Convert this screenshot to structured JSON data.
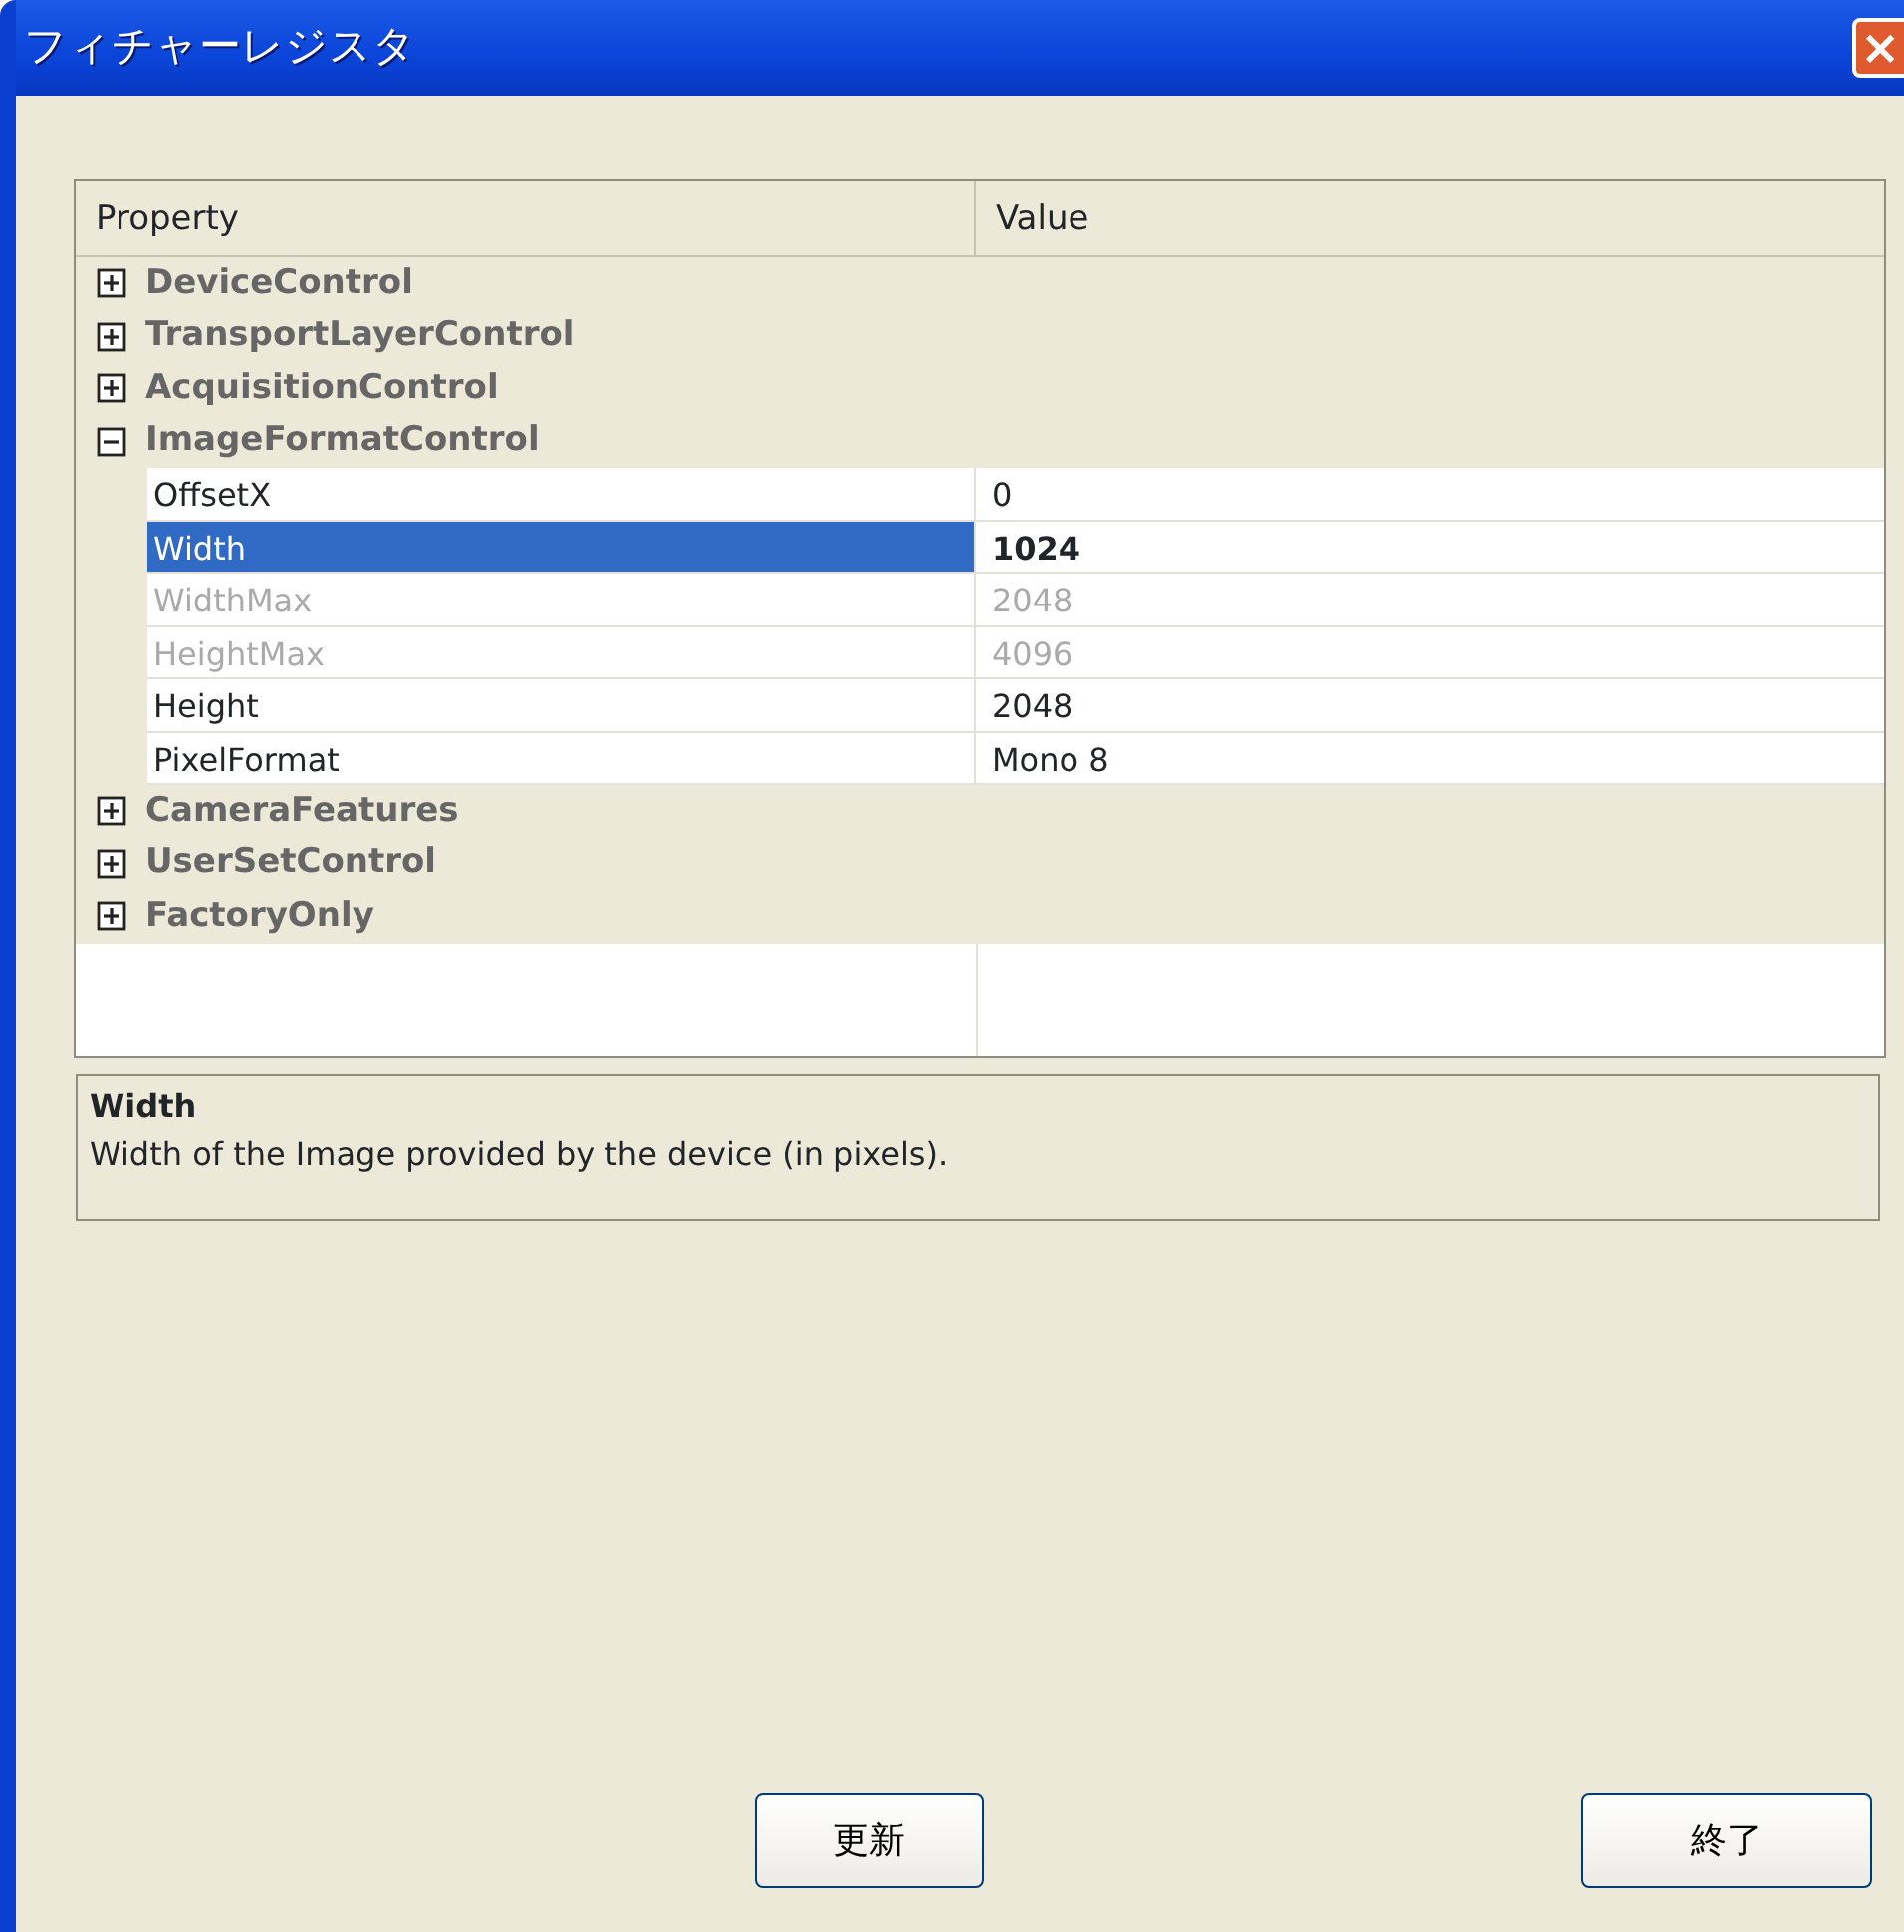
{
  "window": {
    "title": "フィチャーレジスタ",
    "close_button": "×"
  },
  "grid": {
    "columns": [
      "Property",
      "Value"
    ],
    "categories": [
      {
        "name": "DeviceControl",
        "expanded": false
      },
      {
        "name": "TransportLayerControl",
        "expanded": false
      },
      {
        "name": "AcquisitionControl",
        "expanded": false
      },
      {
        "name": "ImageFormatControl",
        "expanded": true,
        "children": [
          {
            "name": "OffsetX",
            "value": "0",
            "disabled": false,
            "selected": false
          },
          {
            "name": "Width",
            "value": "1024",
            "disabled": false,
            "selected": true
          },
          {
            "name": "WidthMax",
            "value": "2048",
            "disabled": true,
            "selected": false
          },
          {
            "name": "HeightMax",
            "value": "4096",
            "disabled": true,
            "selected": false
          },
          {
            "name": "Height",
            "value": "2048",
            "disabled": false,
            "selected": false
          },
          {
            "name": "PixelFormat",
            "value": "Mono 8",
            "disabled": false,
            "selected": false
          }
        ]
      },
      {
        "name": "CameraFeatures",
        "expanded": false
      },
      {
        "name": "UserSetControl",
        "expanded": false
      },
      {
        "name": "FactoryOnly",
        "expanded": false
      }
    ]
  },
  "description": {
    "title": "Width",
    "text": "Width of the Image provided by the device (in pixels)."
  },
  "buttons": [
    "更新",
    "終了"
  ]
}
